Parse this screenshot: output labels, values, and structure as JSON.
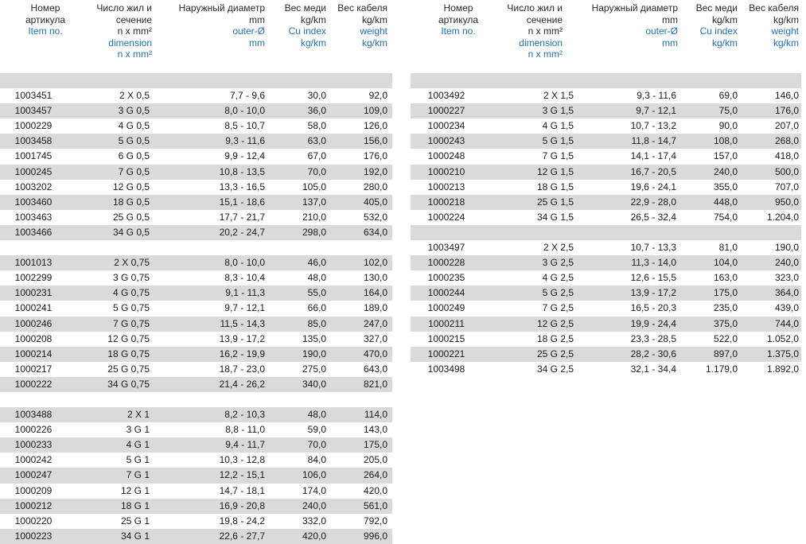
{
  "headers": [
    {
      "ru": [
        "Номер",
        "артикула"
      ],
      "en": [
        "Item no."
      ]
    },
    {
      "ru": [
        "Число жил и",
        "сечение",
        "n x mm²"
      ],
      "en": [
        "dimension",
        "n x mm²"
      ]
    },
    {
      "ru": [
        "Наружный диаметр",
        "mm"
      ],
      "en": [
        "outer-Ø",
        "mm"
      ]
    },
    {
      "ru": [
        "Вес меди",
        "kg/km"
      ],
      "en": [
        "Cu index",
        "kg/km"
      ]
    },
    {
      "ru": [
        "Вес кабеля",
        "kg/km"
      ],
      "en": [
        "weight",
        "kg/km"
      ]
    }
  ],
  "colors": {
    "header_en": "#1f6fba",
    "row_shade": "#dadada"
  },
  "left_rows": [
    null,
    [
      "1003451",
      "2 X 0,5",
      "7,7 - 9,6",
      "30,0",
      "92,0"
    ],
    [
      "1003457",
      "3 G 0,5",
      "8,0 - 10,0",
      "36,0",
      "109,0"
    ],
    [
      "1000229",
      "4 G 0,5",
      "8,5 - 10,7",
      "58,0",
      "126,0"
    ],
    [
      "1003458",
      "5 G 0,5",
      "9,3 - 11,6",
      "63,0",
      "156,0"
    ],
    [
      "1001745",
      "6 G 0,5",
      "9,9 - 12,4",
      "67,0",
      "176,0"
    ],
    [
      "1000245",
      "7 G 0,5",
      "10,8 - 13,5",
      "70,0",
      "192,0"
    ],
    [
      "1003202",
      "12 G 0,5",
      "13,3 - 16,5",
      "105,0",
      "280,0"
    ],
    [
      "1003460",
      "18 G 0,5",
      "15,1 - 18,6",
      "137,0",
      "405,0"
    ],
    [
      "1003463",
      "25 G 0,5",
      "17,7 - 21,7",
      "210,0",
      "532,0"
    ],
    [
      "1003466",
      "34 G 0,5",
      "20,2 - 24,7",
      "298,0",
      "634,0"
    ],
    null,
    [
      "1001013",
      "2 X 0,75",
      "8,0 - 10,0",
      "46,0",
      "102,0"
    ],
    [
      "1002299",
      "3 G 0,75",
      "8,3 - 10,4",
      "48,0",
      "130,0"
    ],
    [
      "1000231",
      "4 G 0,75",
      "9,1 - 11,3",
      "55,0",
      "164,0"
    ],
    [
      "1000241",
      "5 G 0,75",
      "9,7 - 12,1",
      "66,0",
      "189,0"
    ],
    [
      "1000246",
      "7 G 0,75",
      "11,5 - 14,3",
      "85,0",
      "247,0"
    ],
    [
      "1000208",
      "12 G 0,75",
      "13,9 - 17,2",
      "135,0",
      "327,0"
    ],
    [
      "1000214",
      "18 G 0,75",
      "16,2 - 19,9",
      "190,0",
      "470,0"
    ],
    [
      "1000217",
      "25 G 0,75",
      "18,7 - 23,0",
      "275,0",
      "643,0"
    ],
    [
      "1000222",
      "34 G 0,75",
      "21,4 - 26,2",
      "340,0",
      "821,0"
    ],
    null,
    [
      "1003488",
      "2 X 1",
      "8,2 - 10,3",
      "48,0",
      "114,0"
    ],
    [
      "1000226",
      "3 G 1",
      "8,8 - 11,0",
      "59,0",
      "143,0"
    ],
    [
      "1000233",
      "4 G 1",
      "9,4 - 11,7",
      "70,0",
      "175,0"
    ],
    [
      "1000242",
      "5 G 1",
      "10,3 - 12,8",
      "84,0",
      "205,0"
    ],
    [
      "1000247",
      "7 G 1",
      "12,2 - 15,1",
      "106,0",
      "264,0"
    ],
    [
      "1000209",
      "12 G 1",
      "14,7 - 18,1",
      "174,0",
      "420,0"
    ],
    [
      "1000212",
      "18 G 1",
      "16,9 - 20,8",
      "240,0",
      "561,0"
    ],
    [
      "1000220",
      "25 G 1",
      "19,8 - 24,2",
      "332,0",
      "792,0"
    ],
    [
      "1000223",
      "34 G 1",
      "22,6 - 27,7",
      "420,0",
      "996,0"
    ]
  ],
  "right_rows": [
    null,
    [
      "1003492",
      "2 X 1,5",
      "9,3 - 11,6",
      "69,0",
      "146,0"
    ],
    [
      "1000227",
      "3 G 1,5",
      "9,7 - 12,1",
      "75,0",
      "176,0"
    ],
    [
      "1000234",
      "4 G 1,5",
      "10,7 - 13,2",
      "90,0",
      "207,0"
    ],
    [
      "1000243",
      "5 G 1,5",
      "11,8 - 14,7",
      "108,0",
      "268,0"
    ],
    [
      "1000248",
      "7 G 1,5",
      "14,1 - 17,4",
      "157,0",
      "418,0"
    ],
    [
      "1000210",
      "12 G 1,5",
      "16,7 - 20,5",
      "240,0",
      "500,0"
    ],
    [
      "1000213",
      "18 G 1,5",
      "19,6 - 24,1",
      "355,0",
      "707,0"
    ],
    [
      "1000218",
      "25 G 1,5",
      "22,9 - 28,0",
      "448,0",
      "950,0"
    ],
    [
      "1000224",
      "34 G 1,5",
      "26,5 - 32,4",
      "754,0",
      "1.204,0"
    ],
    null,
    [
      "1003497",
      "2 X 2,5",
      "10,7 - 13,3",
      "81,0",
      "190,0"
    ],
    [
      "1000228",
      "3 G 2,5",
      "11,3 - 14,0",
      "104,0",
      "240,0"
    ],
    [
      "1000235",
      "4 G 2,5",
      "12,6 - 15,5",
      "163,0",
      "323,0"
    ],
    [
      "1000244",
      "5 G 2,5",
      "13,9 - 17,2",
      "175,0",
      "364,0"
    ],
    [
      "1000249",
      "7 G 2,5",
      "16,5 - 20,3",
      "235,0",
      "439,0"
    ],
    [
      "1000211",
      "12 G 2,5",
      "19,9 - 24,4",
      "375,0",
      "744,0"
    ],
    [
      "1000215",
      "18 G 2,5",
      "23,3 - 28,5",
      "522,0",
      "1.052,0"
    ],
    [
      "1000221",
      "25 G 2,5",
      "28,2 - 30,6",
      "897,0",
      "1.375,0"
    ],
    [
      "1003498",
      "34 G 2,5",
      "32,1 - 34,4",
      "1.179,0",
      "1.892,0"
    ]
  ]
}
